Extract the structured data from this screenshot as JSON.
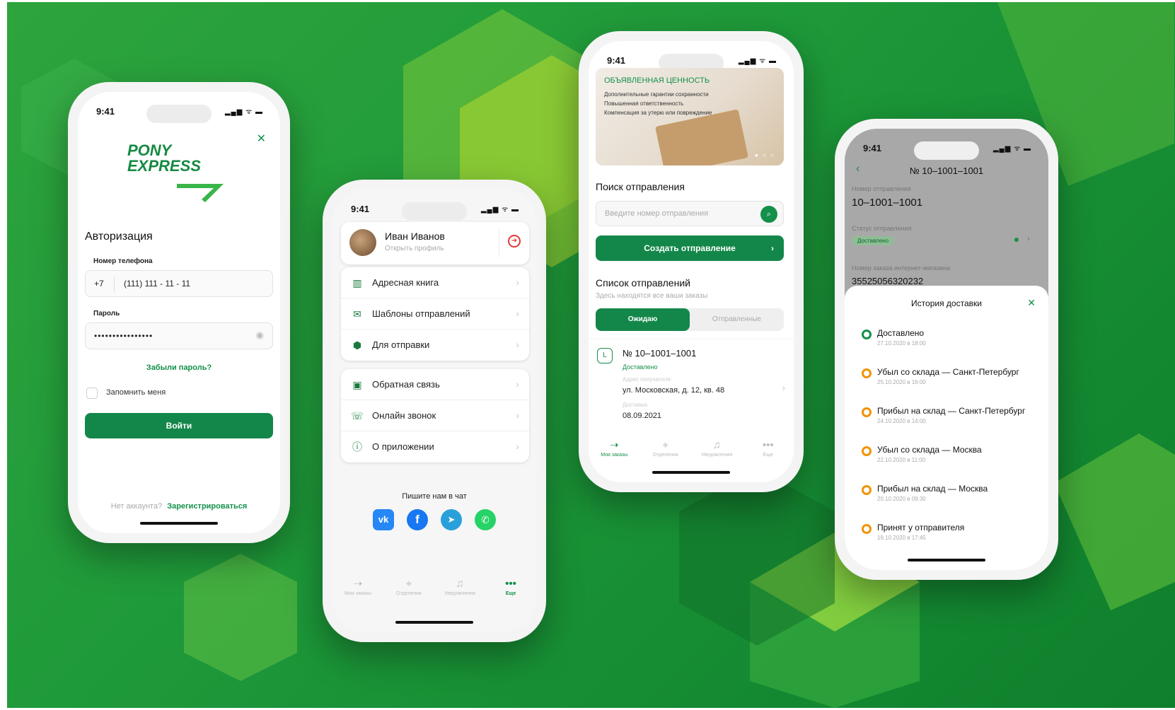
{
  "colors": {
    "brand_green": "#14904a",
    "accent_orange": "#f39200",
    "danger_red": "#e53935"
  },
  "status": {
    "time": "9:41"
  },
  "login": {
    "logo_line1": "PONY",
    "logo_line2": "EXPRESS",
    "heading": "Авторизация",
    "phone_label": "Номер телефона",
    "phone_prefix": "+7",
    "phone_value": "(111) 111 - 11 - 11",
    "password_label": "Пароль",
    "password_value": "••••••••••••••••",
    "forgot_link": "Забыли пароль?",
    "remember_label": "Запомнить меня",
    "login_button": "Войти",
    "no_account": "Нет аккаунта?",
    "register_link": "Зарегистрироваться"
  },
  "profile": {
    "name": "Иван Иванов",
    "open_profile": "Открыть профиль",
    "menu_group1": [
      {
        "label": "Адресная книга",
        "icon": "book-icon"
      },
      {
        "label": "Шаблоны отправлений",
        "icon": "template-icon"
      },
      {
        "label": "Для отправки",
        "icon": "box-icon"
      }
    ],
    "menu_group2": [
      {
        "label": "Обратная связь",
        "icon": "feedback-icon"
      },
      {
        "label": "Онлайн звонок",
        "icon": "phone-icon"
      },
      {
        "label": "О приложении",
        "icon": "info-icon"
      }
    ],
    "chat_title": "Пишите нам в чат",
    "tabs": [
      "Мои заказы",
      "Отделения",
      "Уведомления",
      "Еще"
    ]
  },
  "orders": {
    "banner_title": "ОБЪЯВЛЕННАЯ ЦЕННОСТЬ",
    "banner_lines": [
      "Дополнительные гарантии сохранности",
      "Повышенная ответственность",
      "Компенсация за утерю или повреждение"
    ],
    "search_title": "Поиск отправления",
    "search_placeholder": "Введите номер отправления",
    "create_button": "Создать отправление",
    "list_title": "Список отправлений",
    "list_subtitle": "Здесь находятся все ваши заказы",
    "segment_waiting": "Ожидаю",
    "segment_sent": "Отправленные",
    "order_badge": "L",
    "order_number": "№ 10–1001–1001",
    "order_status": "Доставлено",
    "address_label": "Адрес получателя:",
    "address_value": "ул. Московская, д. 12, кв. 48",
    "delivery_label": "Доставка:",
    "delivery_value": "08.09.2021",
    "tabs": [
      "Мои заказы",
      "Отделения",
      "Уведомления",
      "Еще"
    ]
  },
  "tracking": {
    "header": "№ 10–1001–1001",
    "number_label": "Номер отправления",
    "number_value": "10–1001–1001",
    "status_label": "Статус отправления",
    "status_badge": "Доставлено",
    "shop_label": "Номер заказа интернет-магазина",
    "shop_value": "35525056320232",
    "history_title": "История доставки",
    "events": [
      {
        "title": "Доставлено",
        "date": "27.10.2020 в 18:00"
      },
      {
        "title": "Убыл со склада — Санкт-Петербург",
        "date": "25.10.2020 в 16:00"
      },
      {
        "title": "Прибыл на склад — Санкт-Петербург",
        "date": "24.10.2020 в 14:00"
      },
      {
        "title": "Убыл со склада — Москва",
        "date": "22.10.2020 в 11:00"
      },
      {
        "title": "Прибыл на склад — Москва",
        "date": "20.10.2020 в 09:30"
      },
      {
        "title": "Принят у отправителя",
        "date": "19.10.2020 в 17:45"
      }
    ]
  }
}
